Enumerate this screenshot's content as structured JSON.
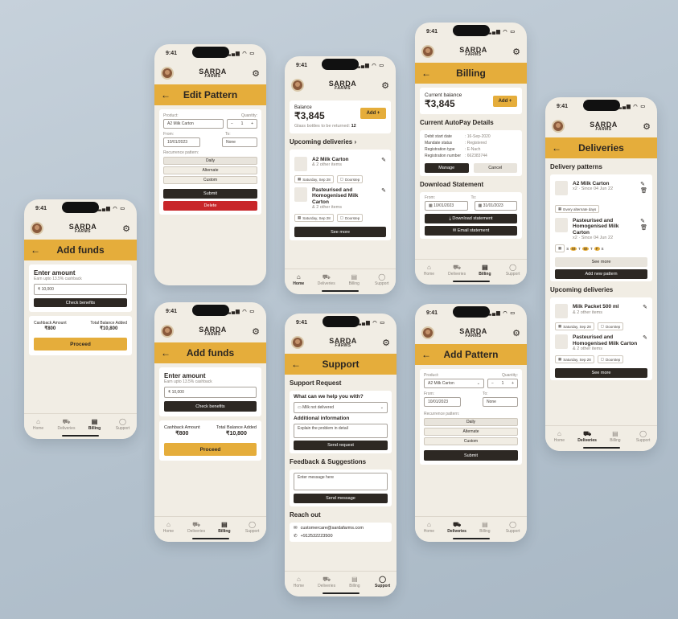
{
  "common": {
    "time": "9:41",
    "signal": "▂▄▆ ◠ ▭",
    "logo_top": "SARDA",
    "logo_bottom": "FARMS",
    "back": "←",
    "gear": "⚙"
  },
  "nav": {
    "home": "Home",
    "deliveries": "Deliveries",
    "billing": "Billing",
    "support": "Support",
    "home_icon": "⌂",
    "deliveries_icon": "⛟",
    "billing_icon": "▤",
    "support_icon": "◯"
  },
  "p1": {
    "title": "Add funds",
    "enter": "Enter amount",
    "earn": "Earn upto 13.5% cashback",
    "value": "₹ 10,000",
    "check": "Check benefits",
    "cb_label": "Cashback Amount",
    "cb_value": "₹800",
    "tb_label": "Total Balance Added",
    "tb_value": "₹10,800",
    "proceed": "Proceed"
  },
  "p2": {
    "title": "Edit Pattern",
    "product_label": "Product:",
    "product": "A2 Milk Carton",
    "qty_label": "Quantity:",
    "qty": "1",
    "minus": "−",
    "plus": "+",
    "from_label": "From:",
    "from": "10/01/2023",
    "to_label": "To:",
    "to": "None",
    "rec": "Recurrence pattern:",
    "daily": "Daily",
    "alternate": "Alternate",
    "custom": "Custom",
    "submit": "Submit",
    "delete": "Delete"
  },
  "p3": {
    "title": "Add funds",
    "enter": "Enter amount",
    "earn": "Earn upto 13.5% cashback",
    "value": "₹ 10,000",
    "check": "Check benefits",
    "cb_label": "Cashback Amount",
    "cb_value": "₹800",
    "tb_label": "Total Balance Added",
    "tb_value": "₹10,800",
    "proceed": "Proceed"
  },
  "p4": {
    "balance_label": "Balance",
    "balance": "₹3,845",
    "add": "Add +",
    "glass": "Glass bottles to be returned:",
    "glass_n": "12",
    "upcoming": "Upcoming deliveries ›",
    "i1_name": "A2 Milk Carton",
    "i1_sub": "& 2 other items",
    "i2_name": "Pasteurised and Homogenised Milk Carton",
    "i2_sub": "& 2 other items",
    "date": "Saturday, Sep 28",
    "door": "Doorstep",
    "see_more": "See more"
  },
  "p5": {
    "title": "Support",
    "req": "Support Request",
    "q": "What can we help you with?",
    "sel": "Milk not delivered",
    "add_info": "Additional information",
    "explain": "Explain the problem in detail",
    "send_req": "Send request",
    "fb": "Feedback & Suggestions",
    "msg": "Enter message here",
    "send_msg": "Send message",
    "reach": "Reach out",
    "email": "customercare@sardafarms.com",
    "phone": "+912532223500"
  },
  "p6": {
    "title": "Billing",
    "cur_label": "Current balance",
    "cur": "₹3,845",
    "add": "Add +",
    "autopay": "Current AutoPay Details",
    "k1": "Debit start date",
    "v1": ": 16-Sep-2020",
    "k2": "Mandate status",
    "v2": ": Registered",
    "k3": "Registration type",
    "v3": ": E-Nach",
    "k4": "Registration number",
    "v4": ": 662383744",
    "manage": "Manage",
    "cancel": "Cancel",
    "download": "Download Statement",
    "from_label": "From:",
    "from": "10/01/2023",
    "to_label": "To:",
    "to": "31/01/2023",
    "dl": "Download statement",
    "email": "Email statement"
  },
  "p7": {
    "title": "Add Pattern",
    "product_label": "Product:",
    "product": "A2 Milk Carton",
    "qty_label": "Quantity:",
    "qty": "1",
    "minus": "−",
    "plus": "+",
    "from_label": "From:",
    "from": "10/01/2023",
    "to_label": "To:",
    "to": "None",
    "rec": "Recurrence pattern:",
    "daily": "Daily",
    "alternate": "Alternate",
    "custom": "Custom",
    "submit": "Submit"
  },
  "p8": {
    "title": "Deliveries",
    "patterns": "Delivery patterns",
    "i1_name": "A2 Milk Carton",
    "i1_sub": "x2 · Since 04 Jun 22",
    "every": "Every alternate days",
    "i2_name": "Pasteurised and Homogenised Milk Carton",
    "i2_sub": "x2 · Since 04 Jun 22",
    "days": [
      "S",
      "M",
      "T",
      "W",
      "T",
      "F",
      "S"
    ],
    "see_more": "See more",
    "add_new": "Add new pattern",
    "upcoming": "Upcoming deliveries",
    "u1_name": "Milk Packet 500 ml",
    "u1_sub": "& 2 other items",
    "u2_name": "Pasteurised and Homogenised Milk Carton",
    "u2_sub": "& 2 other items",
    "date": "Saturday, Sep 28",
    "door": "Doorstep",
    "see_more2": "See more"
  }
}
